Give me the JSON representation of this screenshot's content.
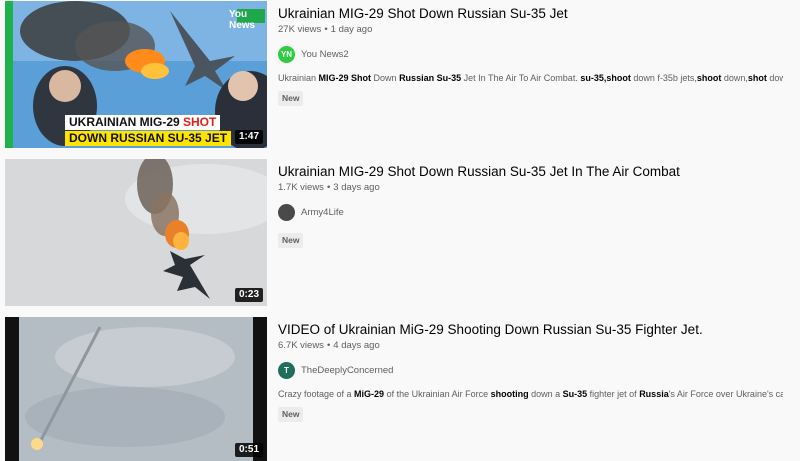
{
  "results": [
    {
      "title": "Ukrainian MIG-29 Shot Down Russian Su-35 Jet",
      "views": "27K views",
      "age": "1 day ago",
      "channel": "You News2",
      "avatar_text": "YN",
      "avatar_color": "#2ecc40",
      "description_parts": [
        {
          "text": "Ukrainian ",
          "bold": false
        },
        {
          "text": "MIG-29 Shot",
          "bold": true
        },
        {
          "text": " Down ",
          "bold": false
        },
        {
          "text": "Russian Su-35",
          "bold": true
        },
        {
          "text": " Jet In The Air To Air Combat. ",
          "bold": false
        },
        {
          "text": "su-35,shoot",
          "bold": true
        },
        {
          "text": " down f-35b jets,",
          "bold": false
        },
        {
          "text": "shoot",
          "bold": true
        },
        {
          "text": " down,",
          "bold": false
        },
        {
          "text": "shot",
          "bold": true
        },
        {
          "text": " down ...",
          "bold": false
        }
      ],
      "badge": "New",
      "duration": "1:47",
      "thumb_brand": "You News",
      "thumb_caption_line1_a": "UKRAINIAN MIG-29 ",
      "thumb_caption_line1_b": "SHOT",
      "thumb_caption_line2": "DOWN RUSSIAN SU-35 JET"
    },
    {
      "title": "Ukrainian MIG-29 Shot Down Russian Su-35 Jet In The Air Combat",
      "views": "1.7K views",
      "age": "3 days ago",
      "channel": "Army4Life",
      "avatar_text": "",
      "avatar_color": "#4a4a4a",
      "description_parts": [],
      "badge": "New",
      "duration": "0:23"
    },
    {
      "title": "VIDEO of Ukrainian MiG-29 Shooting Down Russian Su-35 Fighter Jet.",
      "views": "6.7K views",
      "age": "4 days ago",
      "channel": "TheDeeplyConcerned",
      "avatar_text": "T",
      "avatar_color": "#1f6f5c",
      "description_parts": [
        {
          "text": "Crazy footage of a ",
          "bold": false
        },
        {
          "text": "MiG-29",
          "bold": true
        },
        {
          "text": " of the Ukrainian Air Force ",
          "bold": false
        },
        {
          "text": "shooting",
          "bold": true
        },
        {
          "text": " down a ",
          "bold": false
        },
        {
          "text": "Su-35",
          "bold": true
        },
        {
          "text": " fighter jet of ",
          "bold": false
        },
        {
          "text": "Russia",
          "bold": true
        },
        {
          "text": "'s Air Force over Ukraine's capital ...",
          "bold": false
        }
      ],
      "badge": "New",
      "duration": "0:51"
    }
  ],
  "meta_separator": "•"
}
